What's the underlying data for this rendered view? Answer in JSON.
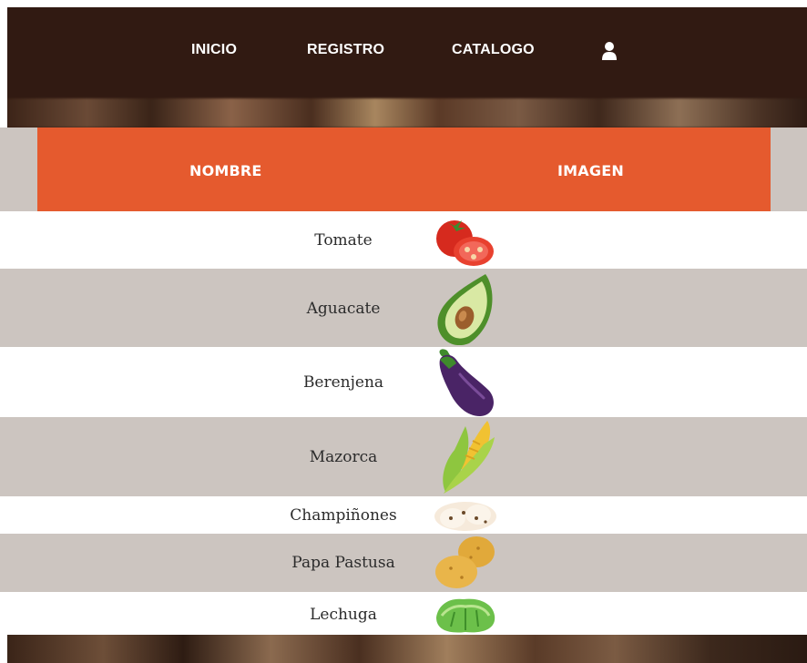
{
  "nav": {
    "items": [
      "INICIO",
      "REGISTRO",
      "CATALOGO"
    ],
    "user_icon": "user-icon"
  },
  "table": {
    "headers": {
      "name": "NOMBRE",
      "image": "IMAGEN"
    },
    "rows": [
      {
        "name": "Tomate",
        "icon": "tomato-icon"
      },
      {
        "name": "Aguacate",
        "icon": "avocado-icon"
      },
      {
        "name": "Berenjena",
        "icon": "eggplant-icon"
      },
      {
        "name": "Mazorca",
        "icon": "corn-icon"
      },
      {
        "name": "Champiñones",
        "icon": "mushroom-icon"
      },
      {
        "name": "Papa Pastusa",
        "icon": "potato-icon"
      },
      {
        "name": "Lechuga",
        "icon": "lettuce-icon"
      }
    ]
  },
  "colors": {
    "nav_bg": "#311a12",
    "header_orange": "#e55a2e",
    "row_gray": "#ccc5c0"
  }
}
